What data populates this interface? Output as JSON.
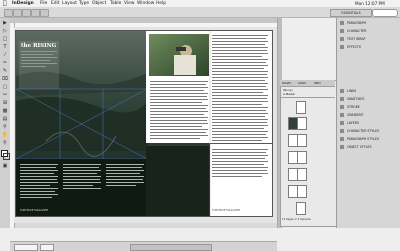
{
  "menu": {
    "app": "InDesign",
    "items": [
      "File",
      "Edit",
      "Layout",
      "Type",
      "Object",
      "Table",
      "View",
      "Window",
      "Help"
    ],
    "clock": "Mon 12:07 PM"
  },
  "controlbar": {
    "workspace": "ESSENTIALS"
  },
  "panels": {
    "items": [
      "PARAGRAPH",
      "CHARACTER",
      "TEXT WRAP",
      "EFFECTS",
      "LINKS",
      "SWATCHES",
      "STROKE",
      "GRADIENT",
      "LAYERS",
      "CHARACTER STYLES",
      "PARAGRAPH STYLES",
      "OBJECT STYLES"
    ],
    "pages_tabs": [
      "PAGES",
      "LINKS",
      "INFO"
    ],
    "pages_masters": [
      "[None]",
      "A-Master"
    ],
    "pages_footer": "12 Pages in 6 Spreads"
  },
  "document": {
    "headline": "the RISING",
    "footer_left": "FORTEKKE MAGAZINE",
    "footer_right": "FORTEKKE MAGAZINE"
  },
  "colors": {
    "accent": "#3a5b8c",
    "page_dark": "#1e2b22",
    "pasteboard": "#e4e4e4"
  }
}
